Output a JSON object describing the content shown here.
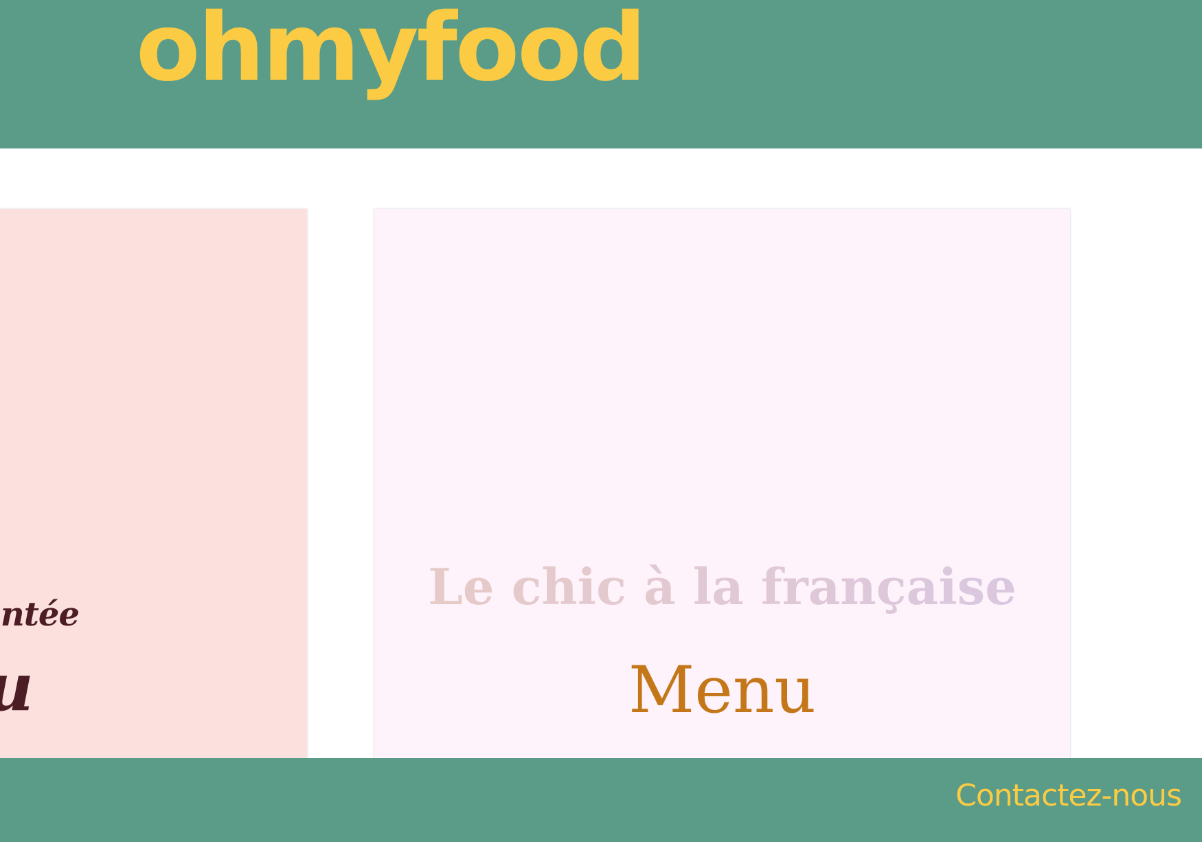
{
  "header": {
    "logo_text": "ohmyfood"
  },
  "left_card": {
    "subtitle": "antée",
    "title": "ou"
  },
  "right_card": {
    "tagline": "Le chic à la française",
    "menu_label": "Menu"
  },
  "footer": {
    "contact_label": "Contactez-nous"
  },
  "colors": {
    "brand_green": "#5a9c88",
    "logo_yellow": "#fccb44",
    "left_card_bg": "#fbe0dd",
    "right_card_bg": "#fef2fb",
    "left_card_text": "#4c1d24",
    "menu_orange": "#c47718"
  }
}
